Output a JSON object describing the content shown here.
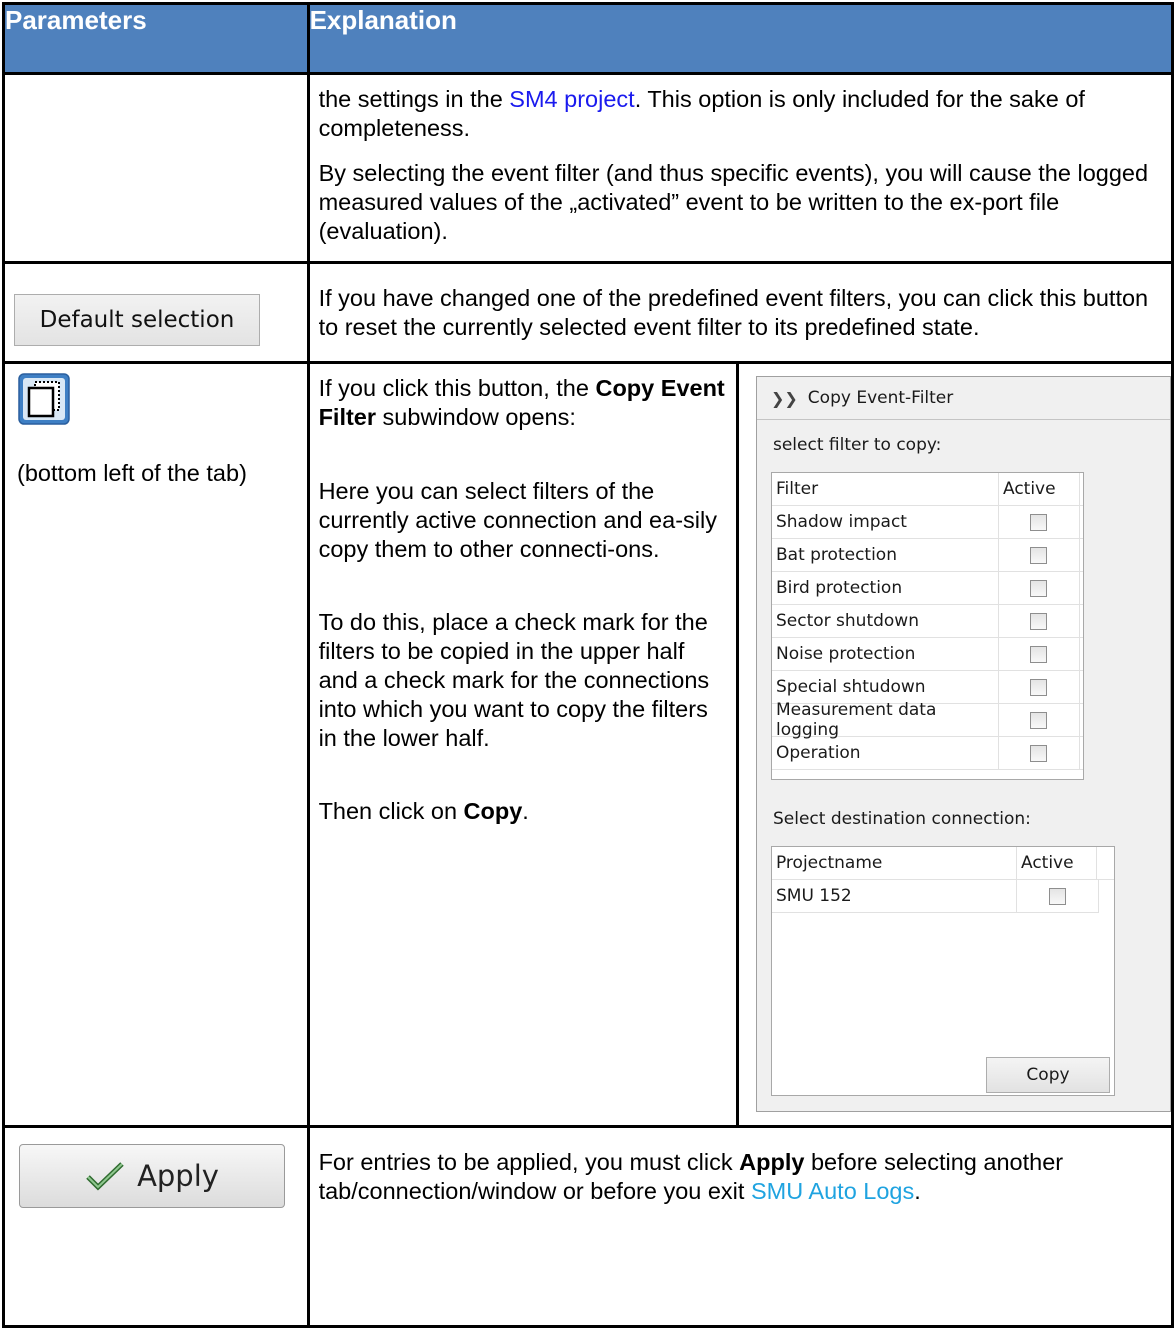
{
  "header": {
    "col1": "Parameters",
    "col2": "Explanation"
  },
  "row1": {
    "p1_before": "the settings in the ",
    "p1_link": "SM4 project",
    "p1_after": ". This option is only included for the sake of completeness.",
    "p2": "By selecting the event filter (and thus specific events), you will cause the logged measured values of the „activated” event to be written to the ex-port file (evaluation)."
  },
  "row2": {
    "button_label": "Default selection",
    "text": "If you have changed one of the predefined event filters, you can click this button to reset the currently selected event filter to its predefined state."
  },
  "row3": {
    "icon_caption": "(bottom left of the tab)",
    "p1_before": "If you click this button, the ",
    "p1_bold": "Copy Event Filter",
    "p1_after": " subwindow opens:",
    "p2": "Here you can select filters of the currently active connection and ea-sily copy them to other connecti-ons.",
    "p3": "To do this, place a check mark for the filters to be copied in the upper half and a check mark for the connections into which you want to copy the filters in the lower half.",
    "p4_before": "Then click on ",
    "p4_bold": "Copy",
    "p4_after": ".",
    "window": {
      "title": "Copy Event-Filter",
      "filter_label": "select filter to copy:",
      "filter_headers": [
        "Filter",
        "Active"
      ],
      "filters": [
        "Shadow impact",
        "Bat protection",
        "Bird protection",
        "Sector shutdown",
        "Noise protection",
        "Special shtudown",
        "Measurement data logging",
        "Operation"
      ],
      "dest_label": "Select destination connection:",
      "dest_headers": [
        "Projectname",
        "Active"
      ],
      "destinations": [
        "SMU 152"
      ],
      "copy_button": "Copy"
    }
  },
  "row4": {
    "button_label": "Apply",
    "t_before": "For entries to be applied, you must click ",
    "t_bold": "Apply",
    "t_mid": " before selecting another tab/connection/window or before you exit ",
    "t_link": "SMU Auto Logs",
    "t_after": "."
  }
}
